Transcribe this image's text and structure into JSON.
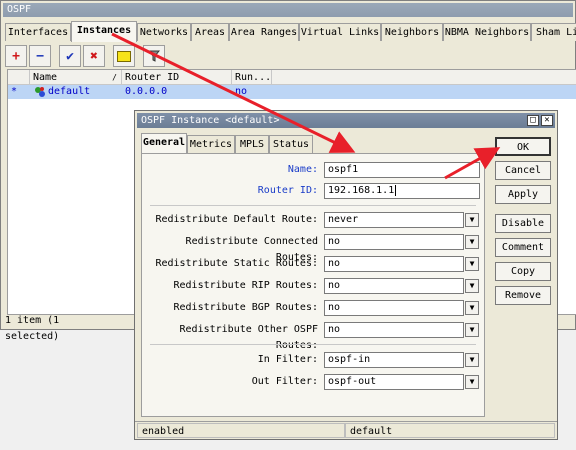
{
  "main": {
    "title": "OSPF",
    "tabs": [
      {
        "label": "Interfaces"
      },
      {
        "label": "Instances"
      },
      {
        "label": "Networks"
      },
      {
        "label": "Areas"
      },
      {
        "label": "Area Ranges"
      },
      {
        "label": "Virtual Links"
      },
      {
        "label": "Neighbors"
      },
      {
        "label": "NBMA Neighbors"
      },
      {
        "label": "Sham Li"
      }
    ],
    "toolbar": {
      "add_icon": "plus-icon",
      "remove_icon": "minus-icon",
      "enable_icon": "check-icon",
      "disable_icon": "x-icon",
      "comment_icon": "note-icon",
      "filter_icon": "filter-icon"
    },
    "columns": [
      "Name",
      "Router ID",
      "Run..."
    ],
    "rows": [
      {
        "flag": "*",
        "name": "default",
        "router_id": "0.0.0.0",
        "running": "no"
      }
    ],
    "status": "1 item (1 selected)"
  },
  "dialog": {
    "title": "OSPF Instance <default>",
    "tabs": [
      "General",
      "Metrics",
      "MPLS",
      "Status"
    ],
    "fields": {
      "name_label": "Name:",
      "name_value": "ospf1",
      "router_id_label": "Router ID:",
      "router_id_value": "192.168.1.1",
      "redist_default_label": "Redistribute Default Route:",
      "redist_default_value": "never",
      "redist_connected_label": "Redistribute Connected Routes:",
      "redist_connected_value": "no",
      "redist_static_label": "Redistribute Static Routes:",
      "redist_static_value": "no",
      "redist_rip_label": "Redistribute RIP Routes:",
      "redist_rip_value": "no",
      "redist_bgp_label": "Redistribute BGP Routes:",
      "redist_bgp_value": "no",
      "redist_ospf_label": "Redistribute Other OSPF Routes:",
      "redist_ospf_value": "no",
      "in_filter_label": "In Filter:",
      "in_filter_value": "ospf-in",
      "out_filter_label": "Out Filter:",
      "out_filter_value": "ospf-out"
    },
    "buttons": [
      "OK",
      "Cancel",
      "Apply",
      "Disable",
      "Comment",
      "Copy",
      "Remove"
    ],
    "status_left": "enabled",
    "status_right": "default"
  },
  "colors": {
    "arrow": "#e8202a",
    "selection": "#bcd5f5",
    "label_blue": "#1a3cc8"
  }
}
